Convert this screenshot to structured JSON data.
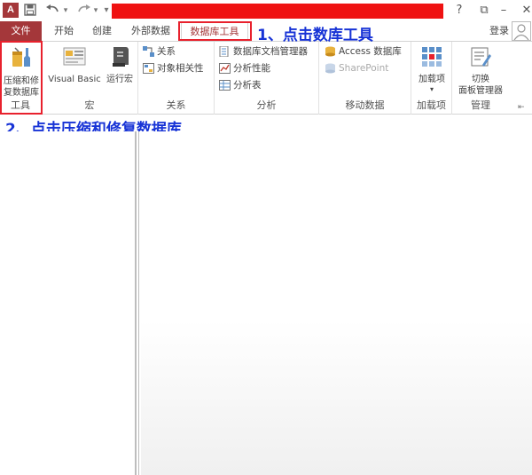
{
  "title_bar": {
    "app_icon_label": "A",
    "buttons": [
      "?",
      "⧉",
      "–",
      "□",
      "✕"
    ]
  },
  "tabs": {
    "file": "文件",
    "home": "开始",
    "create": "创建",
    "external": "外部数据",
    "db_tools": "数据库工具",
    "active": "数据库工具"
  },
  "sign_in": "登录",
  "annotations": {
    "step1": "1、点击数库工具",
    "step2": "2、点击压缩和修复数据库"
  },
  "ribbon": {
    "tools": {
      "group": "工具",
      "compact_repair_line1": "压缩和修",
      "compact_repair_line2": "复数据库"
    },
    "macro": {
      "group": "宏",
      "visual_basic": "Visual Basic",
      "run_macro": "运行宏"
    },
    "relationships": {
      "group": "关系",
      "relationships": "关系",
      "object_dependencies": "对象相关性"
    },
    "analyze": {
      "group": "分析",
      "documenter": "数据库文档管理器",
      "analyze_performance": "分析性能",
      "analyze_table": "分析表"
    },
    "move_data": {
      "group": "移动数据",
      "access_database": "Access 数据库",
      "sharepoint": "SharePoint"
    },
    "addins": {
      "group": "加载项",
      "addins": "加载项"
    },
    "management": {
      "group": "管理",
      "switchboard_line1": "切换",
      "switchboard_line2": "面板管理器"
    }
  },
  "colors": {
    "brand": "#a4373a",
    "highlight": "#e8212d",
    "annotation": "#1733d6",
    "redaction": "#ef1212"
  }
}
